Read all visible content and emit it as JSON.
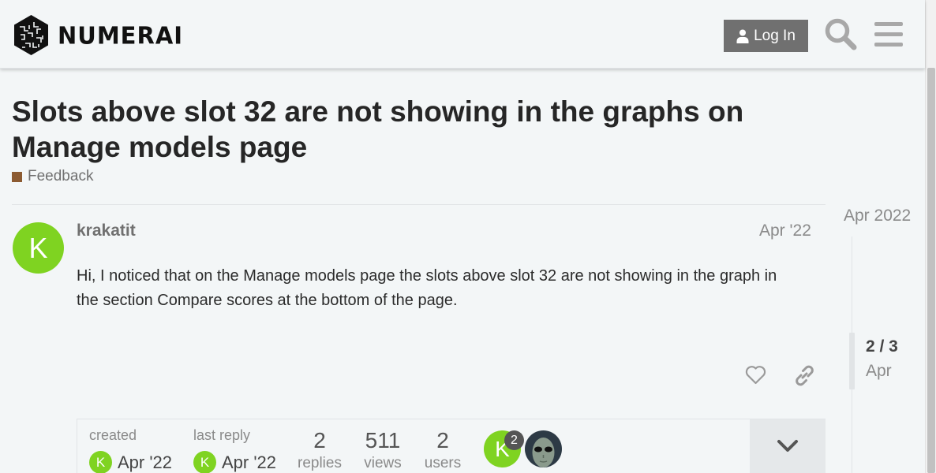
{
  "header": {
    "brand": "NUMERAI",
    "login_label": "Log In",
    "icons": [
      "numerai-logo-icon",
      "user-icon",
      "search-icon",
      "hamburger-menu-icon"
    ]
  },
  "topic": {
    "title": "Slots above slot 32 are not showing in the graphs on Manage models page",
    "category": "Feedback",
    "category_color": "#8c5b32"
  },
  "post": {
    "avatar_letter": "K",
    "avatar_color": "#7fd321",
    "username": "krakatit",
    "date": "Apr '22",
    "body": "Hi, I noticed that on the Manage models page the slots above slot 32 are not showing in the graph in the section Compare scores at the bottom of the page.",
    "actions": [
      "heart-icon",
      "link-icon"
    ]
  },
  "summary": {
    "created_label": "created",
    "created_date": "Apr '22",
    "last_reply_label": "last reply",
    "last_reply_date": "Apr '22",
    "replies_count": "2",
    "replies_label": "replies",
    "views_count": "511",
    "views_label": "views",
    "users_count": "2",
    "users_label": "users",
    "participant_badge": "2",
    "participant_letter": "K"
  },
  "timeline": {
    "start_date": "Apr 2022",
    "position": "2 / 3",
    "current_date": "Apr"
  }
}
